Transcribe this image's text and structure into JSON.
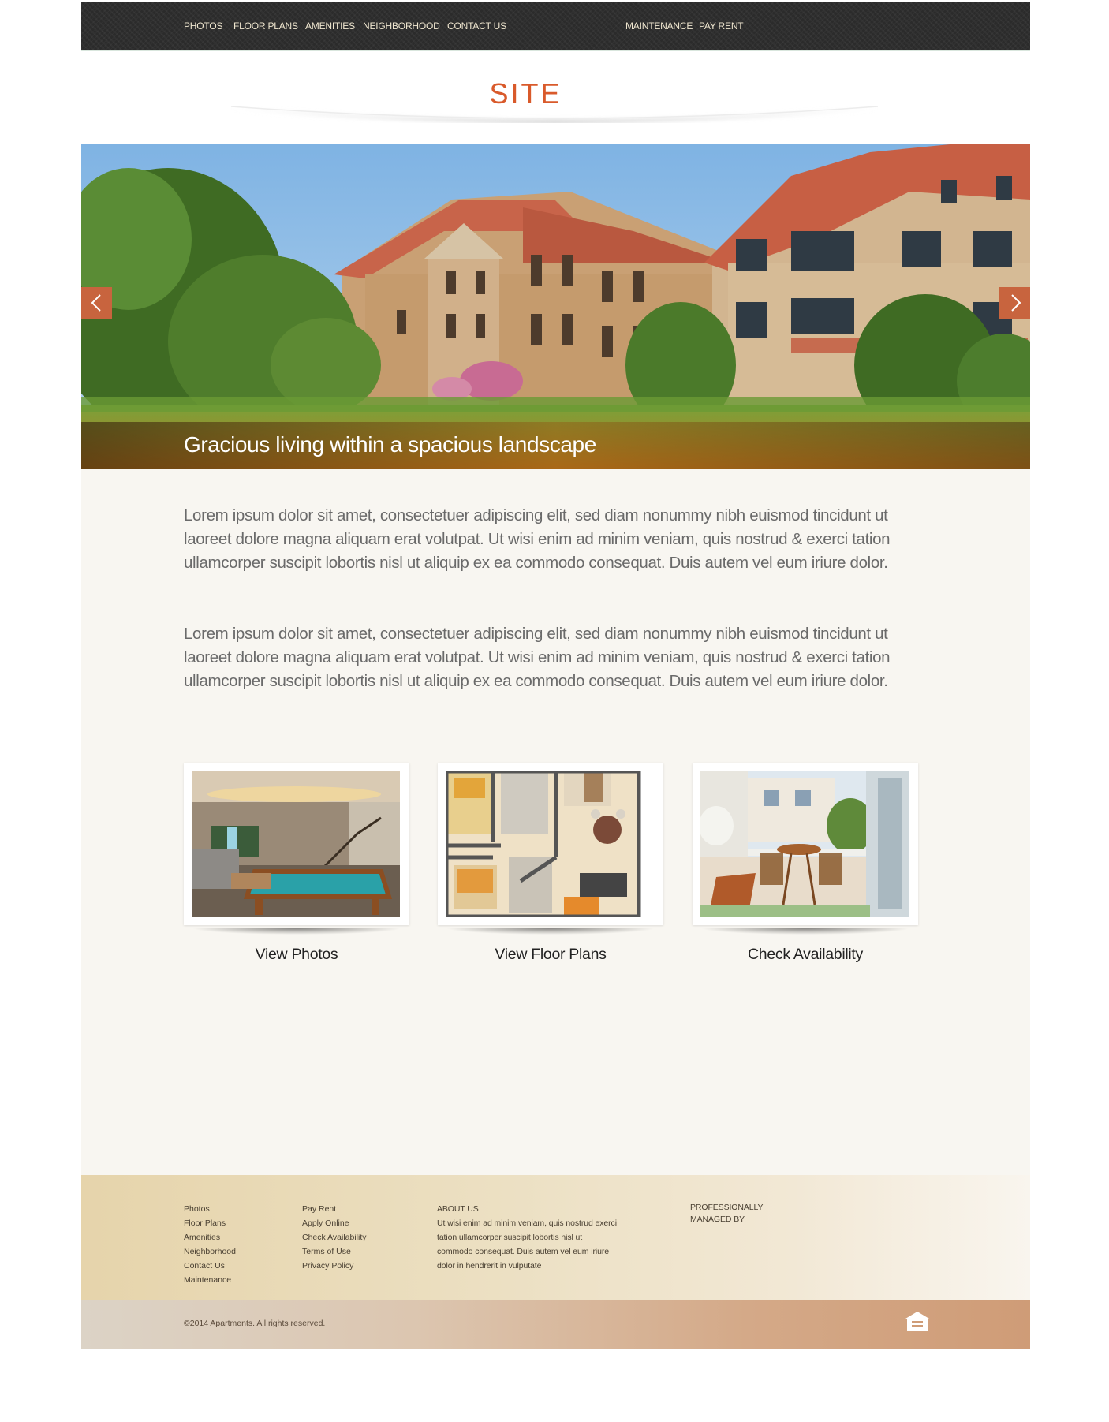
{
  "nav": {
    "left": [
      {
        "label": "PHOTOS"
      },
      {
        "label": "FLOOR PLANS"
      },
      {
        "label": "AMENITIES"
      },
      {
        "label": "NEIGHBORHOOD"
      },
      {
        "label": "CONTACT US"
      }
    ],
    "right": [
      {
        "label": "MAINTENANCE"
      },
      {
        "label": "PAY RENT"
      }
    ]
  },
  "header": {
    "title": "SITE"
  },
  "hero": {
    "caption": "Gracious living within a spacious landscape",
    "prev_icon": "chevron-left-icon",
    "next_icon": "chevron-right-icon"
  },
  "content": {
    "paragraphs": [
      "Lorem ipsum dolor sit amet, consectetuer adipiscing elit, sed diam nonummy nibh euismod tincidunt ut laoreet dolore magna aliquam erat volutpat. Ut wisi enim ad minim veniam, quis nostrud & exerci tation ullamcorper suscipit lobortis nisl ut aliquip ex ea commodo consequat. Duis autem vel eum iriure dolor.",
      "Lorem ipsum dolor sit amet, consectetuer adipiscing elit, sed diam nonummy nibh euismod tincidunt ut laoreet dolore magna aliquam erat volutpat. Ut wisi enim ad minim veniam, quis nostrud & exerci tation ullamcorper suscipit lobortis nisl ut aliquip ex ea commodo consequat. Duis autem vel eum iriure dolor."
    ],
    "cards": [
      {
        "label": "View Photos"
      },
      {
        "label": "View Floor Plans"
      },
      {
        "label": "Check Availability"
      }
    ]
  },
  "footer": {
    "col1": [
      "Photos",
      "Floor Plans",
      "Amenities",
      "Neighborhood",
      "Contact Us",
      "Maintenance"
    ],
    "col2": [
      "Pay Rent",
      "Apply Online",
      "Check Availability",
      "Terms of Use",
      "Privacy Policy"
    ],
    "about": {
      "heading": "ABOUT US",
      "text": "Ut wisi enim ad minim veniam, quis nostrud exerci tation ullamcorper suscipit lobortis nisl ut commodo consequat. Duis autem vel eum iriure dolor in hendrerit in vulputate"
    },
    "managed": {
      "line1": "PROFESSIONALLY",
      "line2": "MANAGED BY"
    },
    "copyright": "©2014 Apartments. All rights reserved.",
    "eho_icon": "equal-housing-icon"
  },
  "colors": {
    "accent": "#d95a2b",
    "arrow": "#c8643e",
    "nav_bg": "#2b2b2b",
    "content_bg": "#f8f6f1",
    "footer_bg": "#e6d4ab"
  }
}
